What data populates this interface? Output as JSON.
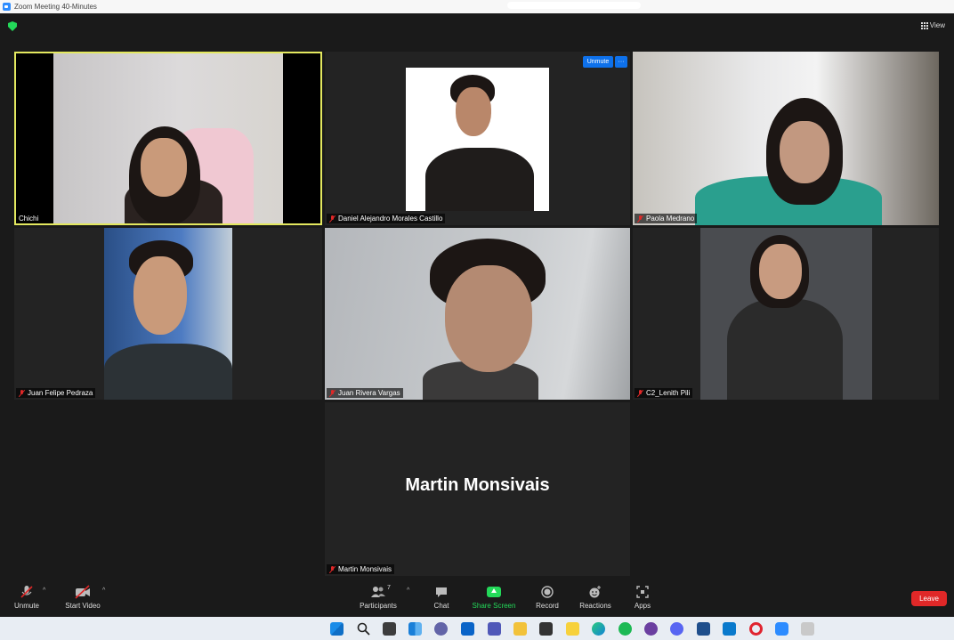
{
  "window": {
    "title": "Zoom Meeting 40-Minutes"
  },
  "toolbar_top": {
    "view_label": "View"
  },
  "participants": [
    {
      "name": "Chichi",
      "muted": false,
      "active_speaker": true
    },
    {
      "name": "Daniel Alejandro Morales Castillo",
      "muted": true
    },
    {
      "name": "Paola Medrano",
      "muted": true
    },
    {
      "name": "Juan Felipe Pedraza",
      "muted": true
    },
    {
      "name": "Juan Rivera Vargas",
      "muted": true
    },
    {
      "name": "C2_Lenith Pili",
      "muted": true
    },
    {
      "name": "Martin Monsivais",
      "muted": true,
      "video_off": true
    }
  ],
  "hover_actions": {
    "unmute_label": "Unmute",
    "more_label": "···"
  },
  "controls": {
    "unmute": "Unmute",
    "start_video": "Start Video",
    "participants": "Participants",
    "participants_count": "7",
    "chat": "Chat",
    "share_screen": "Share Screen",
    "record": "Record",
    "reactions": "Reactions",
    "apps": "Apps",
    "leave": "Leave"
  },
  "colors": {
    "background": "#1a1a1a",
    "active_speaker": "#e3e85f",
    "share_green": "#23d959",
    "leave_red": "#e02828",
    "unmute_blue": "#0e71eb"
  },
  "taskbar_icons": [
    "windows-start",
    "search",
    "task-view",
    "widgets",
    "chat",
    "mail",
    "teams",
    "file-explorer",
    "store",
    "sticky-notes",
    "edge",
    "spotify",
    "github",
    "discord",
    "powershell",
    "vscode",
    "opera",
    "zoom",
    "app"
  ]
}
